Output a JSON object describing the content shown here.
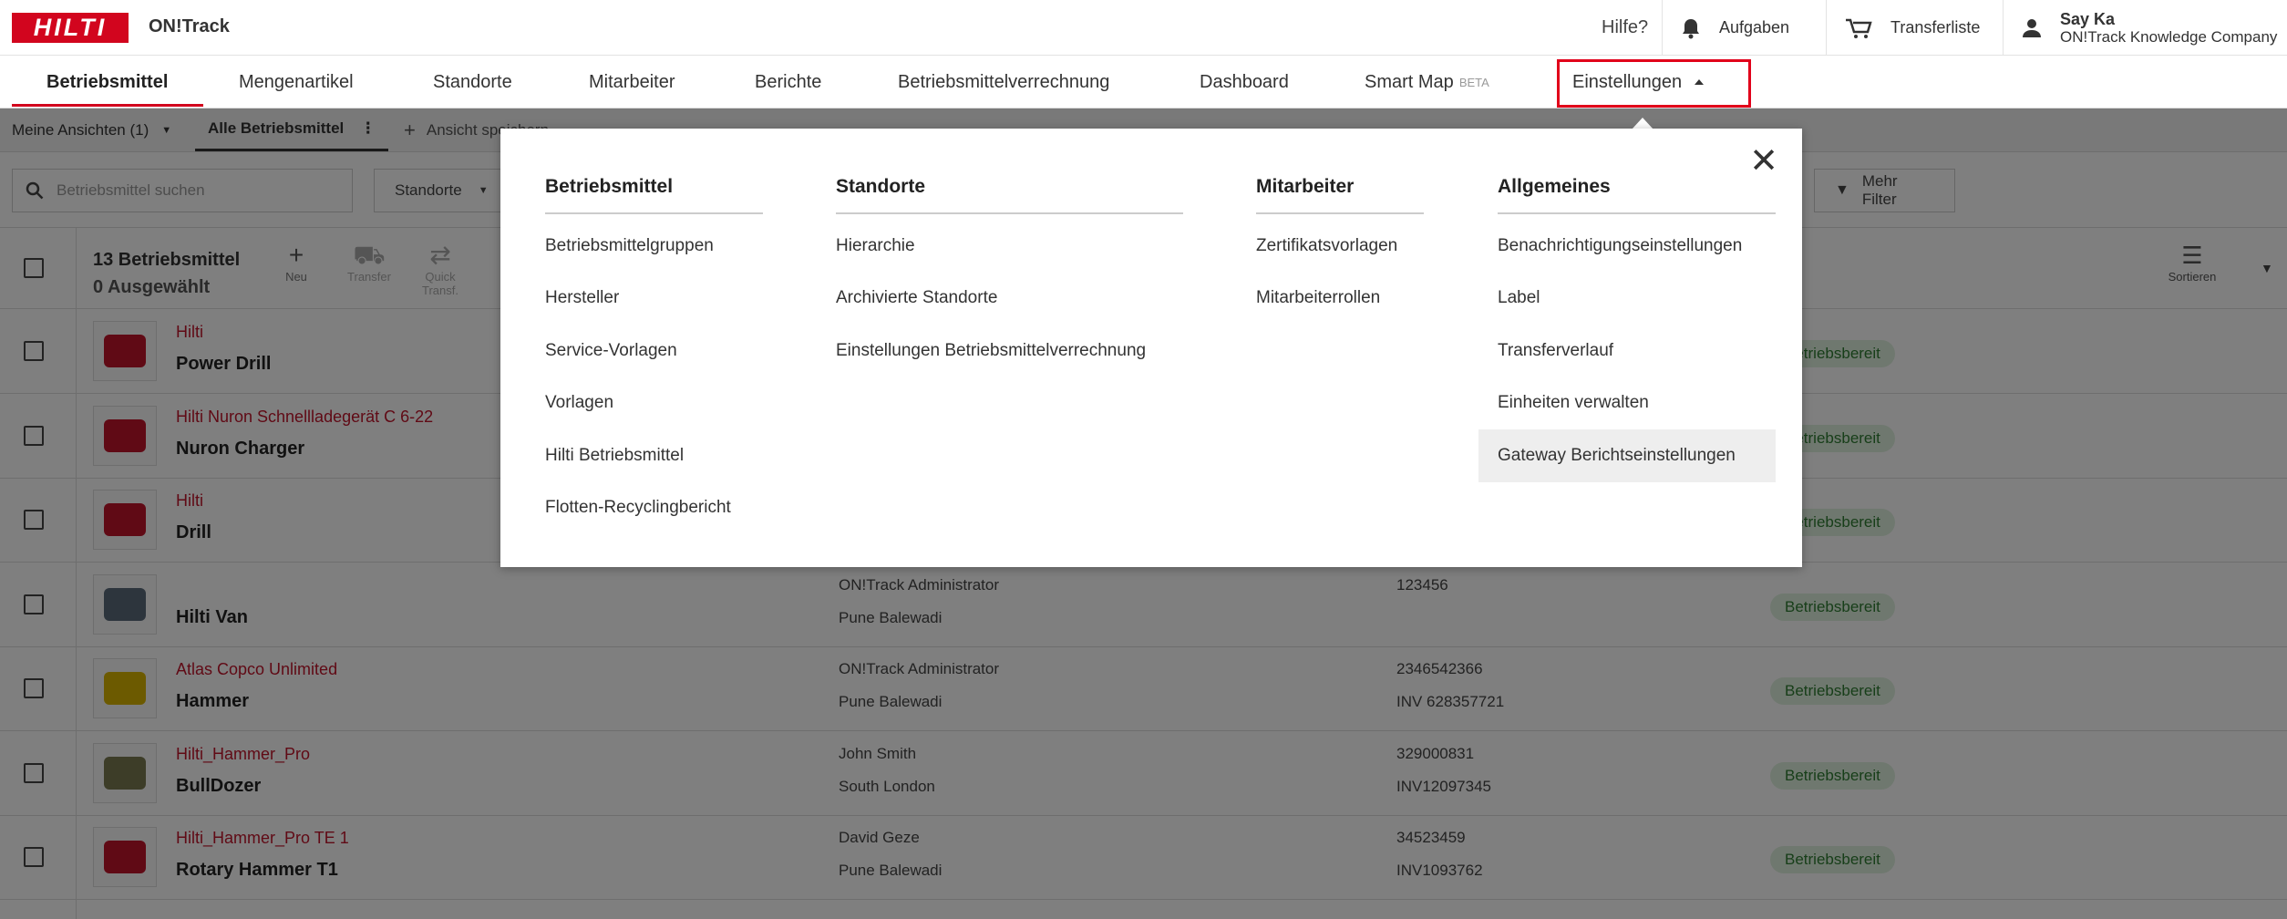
{
  "app": {
    "logo_text": "HILTI",
    "name": "ON!Track"
  },
  "topbar": {
    "help": "Hilfe?",
    "tasks": "Aufgaben",
    "transfer_list": "Transferliste",
    "user_name": "Say Ka",
    "user_company": "ON!Track Knowledge Company"
  },
  "nav": {
    "tabs": [
      {
        "label": "Betriebsmittel"
      },
      {
        "label": "Mengenartikel"
      },
      {
        "label": "Standorte"
      },
      {
        "label": "Mitarbeiter"
      },
      {
        "label": "Berichte"
      },
      {
        "label": "Betriebsmittelverrechnung"
      },
      {
        "label": "Dashboard"
      },
      {
        "label": "Smart Map"
      },
      {
        "label": "Einstellungen"
      }
    ],
    "beta": "BETA"
  },
  "views": {
    "my_views": "Meine Ansichten (1)",
    "all_assets": "Alle Betriebsmittel",
    "save_view": "Ansicht speichern"
  },
  "filters": {
    "search_placeholder": "Betriebsmittel suchen",
    "locations": "Standorte",
    "more_filters": "Mehr Filter"
  },
  "toolbar": {
    "count": "13 Betriebsmittel",
    "selected": "0 Ausgewählt",
    "new": "Neu",
    "transfer": "Transfer",
    "quick_transfer": "Quick Transf.",
    "sort": "Sortieren"
  },
  "rows": [
    {
      "brand": "Hilti",
      "name": "Power Drill",
      "c2a": "",
      "c2b": "",
      "c3a": "",
      "c3b": "",
      "status": "Betriebsbereit"
    },
    {
      "brand": "Hilti Nuron Schnellladegerät C 6-22",
      "name": "Nuron Charger",
      "c2a": "",
      "c2b": "",
      "c3a": "",
      "c3b": "",
      "status": "Betriebsbereit"
    },
    {
      "brand": "Hilti",
      "name": "Drill",
      "c2a": "",
      "c2b": "",
      "c3a": "",
      "c3b": "",
      "status": "Betriebsbereit"
    },
    {
      "brand": "",
      "name": "Hilti Van",
      "c2a": "ON!Track Administrator",
      "c2b": "Pune Balewadi",
      "c3a": "123456",
      "c3b": "",
      "status": "Betriebsbereit"
    },
    {
      "brand": "Atlas Copco Unlimited",
      "name": "Hammer",
      "c2a": "ON!Track Administrator",
      "c2b": "Pune Balewadi",
      "c3a": "2346542366",
      "c3b": "INV 628357721",
      "status": "Betriebsbereit"
    },
    {
      "brand": "Hilti_Hammer_Pro",
      "name": "BullDozer",
      "c2a": "John Smith",
      "c2b": "South London",
      "c3a": "329000831",
      "c3b": "INV12097345",
      "status": "Betriebsbereit"
    },
    {
      "brand": "Hilti_Hammer_Pro TE 1",
      "name": "Rotary Hammer T1",
      "c2a": "David Geze",
      "c2b": "Pune Balewadi",
      "c3a": "34523459",
      "c3b": "INV1093762",
      "status": "Betriebsbereit"
    }
  ],
  "menu": {
    "columns": [
      {
        "title": "Betriebsmittel",
        "items": [
          "Betriebsmittelgruppen",
          "Hersteller",
          "Service-Vorlagen",
          "Vorlagen",
          "Hilti Betriebsmittel",
          "Flotten-Recyclingbericht"
        ]
      },
      {
        "title": "Standorte",
        "items": [
          "Hierarchie",
          "Archivierte Standorte",
          "Einstellungen Betriebsmittelverrechnung"
        ]
      },
      {
        "title": "Mitarbeiter",
        "items": [
          "Zertifikatsvorlagen",
          "Mitarbeiterrollen"
        ]
      },
      {
        "title": "Allgemeines",
        "items": [
          "Benachrichtigungseinstellungen",
          "Label",
          "Transferverlauf",
          "Einheiten verwalten",
          "Gateway Berichtseinstellungen"
        ]
      }
    ]
  },
  "colors": {
    "brand_red": "#d2051e",
    "status_green": "#2e7d32"
  }
}
